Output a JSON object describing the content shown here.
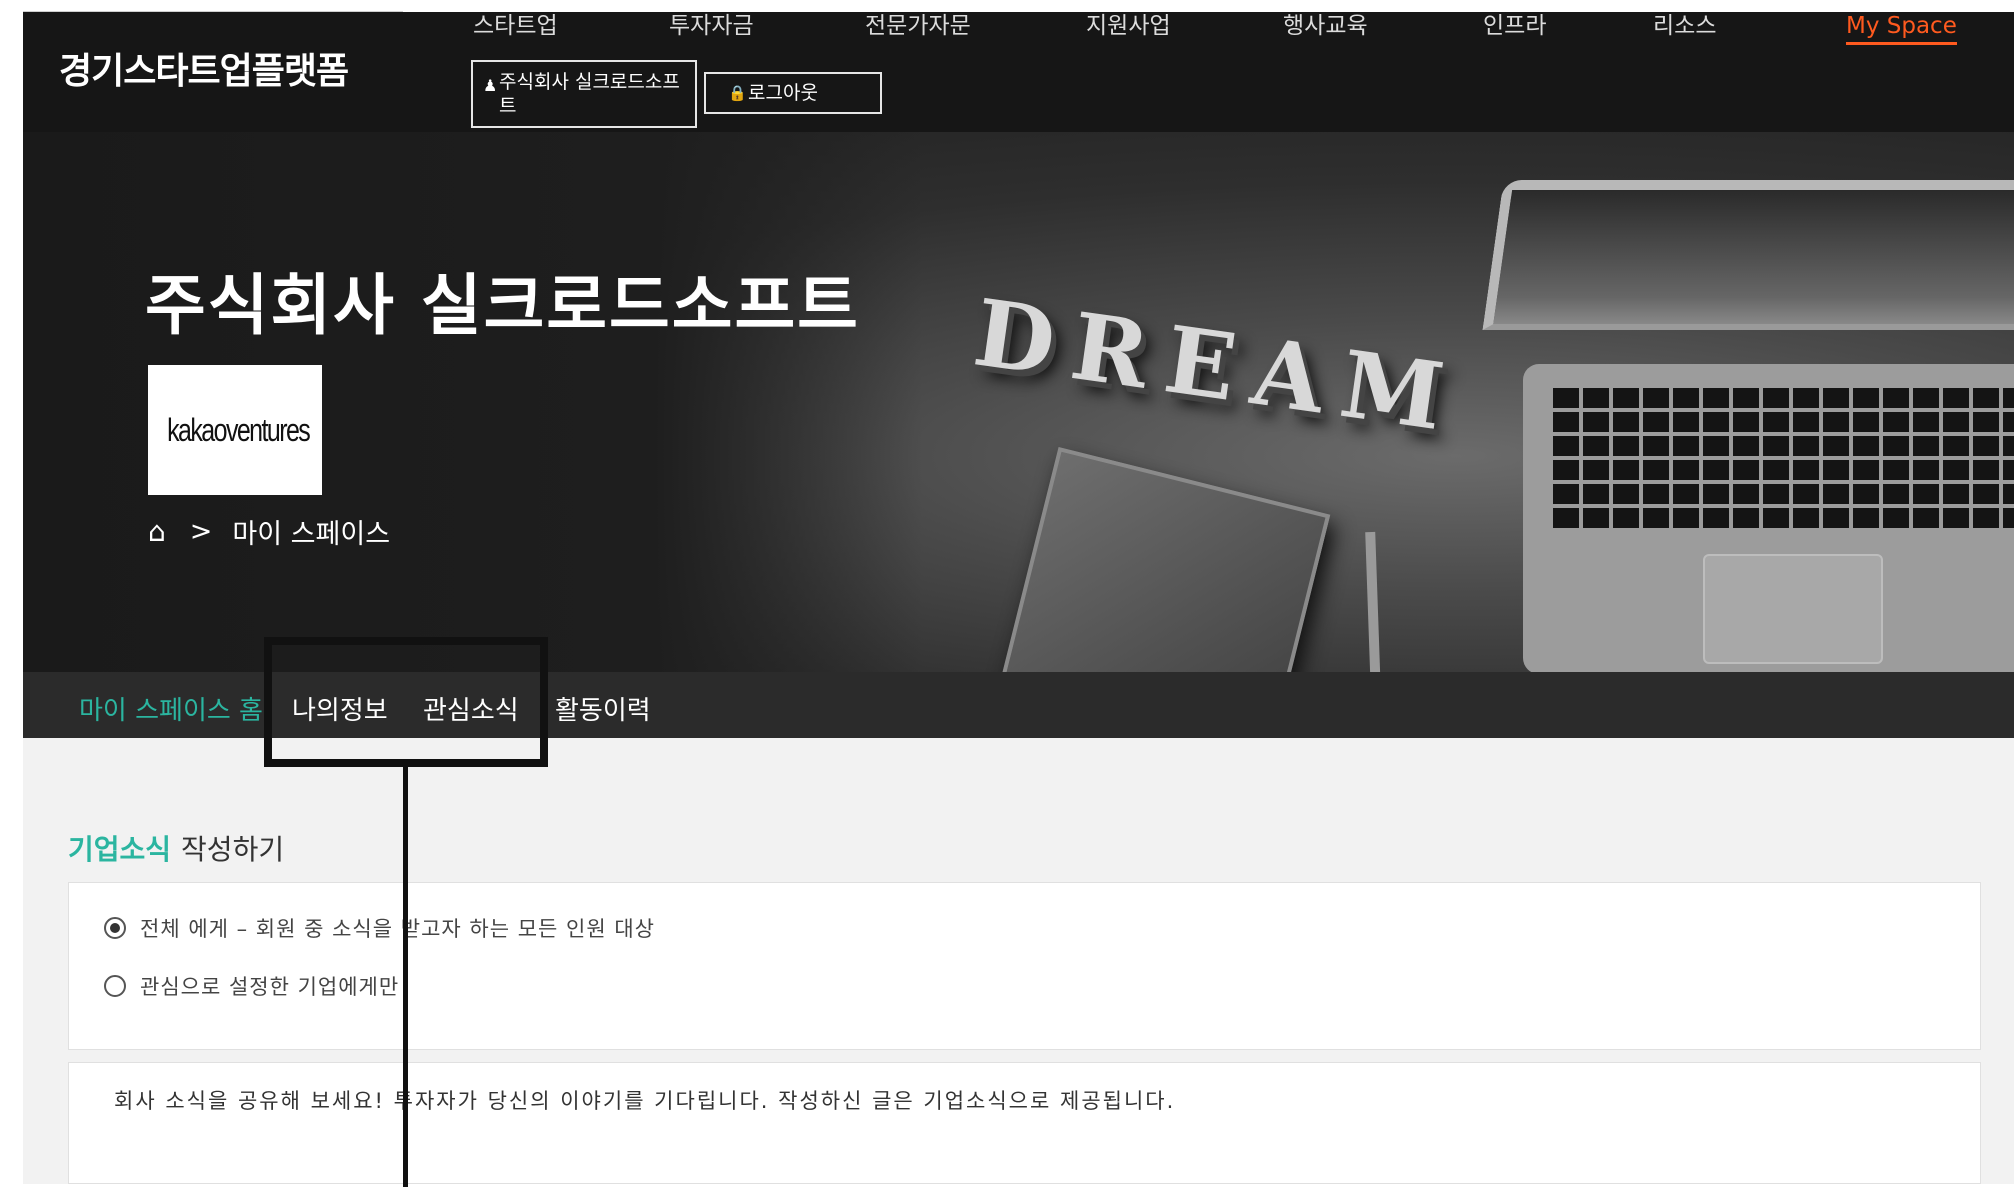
{
  "header": {
    "brand": "경기스타트업플랫폼",
    "nav": [
      "스타트업",
      "투자자금",
      "전문가자문",
      "지원사업",
      "행사교육",
      "인프라",
      "리소스",
      "My Space"
    ],
    "user_button": "주식회사 실크로드소프트",
    "logout_button": "로그아웃"
  },
  "hero": {
    "company_name": "주식회사 실크로드소프트",
    "logo_text": "kakaoventures",
    "background_word": "DREAM",
    "breadcrumb_sep": ">",
    "breadcrumb_current": "마이 스페이스"
  },
  "tabs": [
    "마이 스페이스 홈",
    "나의정보",
    "관심소식",
    "활동이력"
  ],
  "content": {
    "title_accent": "기업소식",
    "title_rest": "작성하기",
    "options": [
      {
        "label": "전체 에게 – 회원 중 소식을 받고자 하는 모든 인원 대상",
        "checked": true
      },
      {
        "label": "관심으로 설정한 기업에게만",
        "checked": false
      }
    ],
    "placeholder": "회사 소식을 공유해 보세요! 투자자가 당신의 이야기를 기다립니다. 작성하신 글은 기업소식으로 제공됩니다."
  },
  "colors": {
    "accent": "#2bb5a0",
    "nav_active": "#ff5a1f",
    "header_bg": "#161616"
  },
  "icons": {
    "user": "user-icon",
    "lock": "lock-icon",
    "home": "home-icon"
  }
}
